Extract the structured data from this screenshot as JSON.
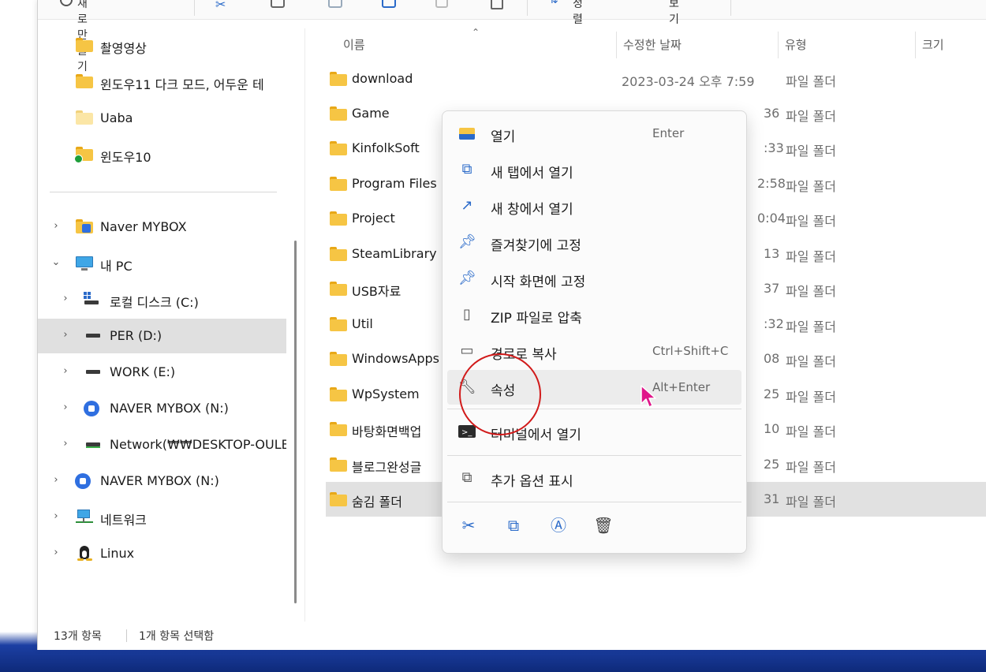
{
  "toolbar": {
    "new_label": "새로 만들기",
    "sort_label": "정렬",
    "view_label": "보기"
  },
  "sidebar": {
    "quick_access": [
      {
        "label": "촬영영상"
      },
      {
        "label": "윈도우11 다크 모드, 어두운 테"
      },
      {
        "label": "Uaba"
      },
      {
        "label": "윈도우10"
      }
    ],
    "tree": [
      {
        "label": "Naver MYBOX"
      },
      {
        "label": "내 PC"
      },
      {
        "label": "로컬 디스크 (C:)"
      },
      {
        "label": "PER (D:)"
      },
      {
        "label": "WORK (E:)"
      },
      {
        "label": "NAVER MYBOX (N:)"
      },
      {
        "label": "Network(₩₩DESKTOP-OULBV"
      },
      {
        "label": "NAVER MYBOX (N:)"
      },
      {
        "label": "네트워크"
      },
      {
        "label": "Linux"
      }
    ]
  },
  "columns": {
    "name": "이름",
    "modified": "수정한 날짜",
    "type": "유형",
    "size": "크기"
  },
  "files": [
    {
      "name": "download",
      "date": "2023-03-24 오후 7:59",
      "type": "파일 폴더"
    },
    {
      "name": "Game",
      "date": "36",
      "type": "파일 폴더"
    },
    {
      "name": "KinfolkSoft",
      "date": ":33",
      "type": "파일 폴더"
    },
    {
      "name": "Program Files",
      "date": "2:58",
      "type": "파일 폴더"
    },
    {
      "name": "Project",
      "date": "0:04",
      "type": "파일 폴더"
    },
    {
      "name": "SteamLibrary",
      "date": "13",
      "type": "파일 폴더"
    },
    {
      "name": "USB자료",
      "date": "37",
      "type": "파일 폴더"
    },
    {
      "name": "Util",
      "date": ":32",
      "type": "파일 폴더"
    },
    {
      "name": "WindowsApps",
      "date": "08",
      "type": "파일 폴더"
    },
    {
      "name": "WpSystem",
      "date": "25",
      "type": "파일 폴더"
    },
    {
      "name": "바탕화면백업",
      "date": "10",
      "type": "파일 폴더"
    },
    {
      "name": "블로그완성글",
      "date": "25",
      "type": "파일 폴더"
    },
    {
      "name": "숨김 폴더",
      "date": "31",
      "type": "파일 폴더"
    }
  ],
  "context_menu": {
    "items": [
      {
        "label": "열기",
        "shortcut": "Enter",
        "icon": "folder-open-icon"
      },
      {
        "label": "새 탭에서 열기",
        "shortcut": "",
        "icon": "new-tab-icon"
      },
      {
        "label": "새 창에서 열기",
        "shortcut": "",
        "icon": "new-window-icon"
      },
      {
        "label": "즐겨찾기에 고정",
        "shortcut": "",
        "icon": "pin-icon"
      },
      {
        "label": "시작 화면에 고정",
        "shortcut": "",
        "icon": "pin-icon"
      },
      {
        "label": "ZIP 파일로 압축",
        "shortcut": "",
        "icon": "zip-icon"
      },
      {
        "label": "경로로 복사",
        "shortcut": "Ctrl+Shift+C",
        "icon": "copy-path-icon"
      },
      {
        "label": "속성",
        "shortcut": "Alt+Enter",
        "icon": "wrench-icon"
      },
      {
        "label": "터미널에서 열기",
        "shortcut": "",
        "icon": "terminal-icon"
      },
      {
        "label": "추가 옵션 표시",
        "shortcut": "",
        "icon": "more-options-icon"
      }
    ],
    "actions": [
      "cut-icon",
      "copy-icon",
      "rename-icon",
      "delete-icon"
    ]
  },
  "status": {
    "item_count": "13개 항목",
    "selected": "1개 항목 선택함"
  },
  "colors": {
    "accent": "#2a6ac9",
    "folder": "#f6c544",
    "annotation": "#d11a1a",
    "cursor": "#e0168a"
  }
}
